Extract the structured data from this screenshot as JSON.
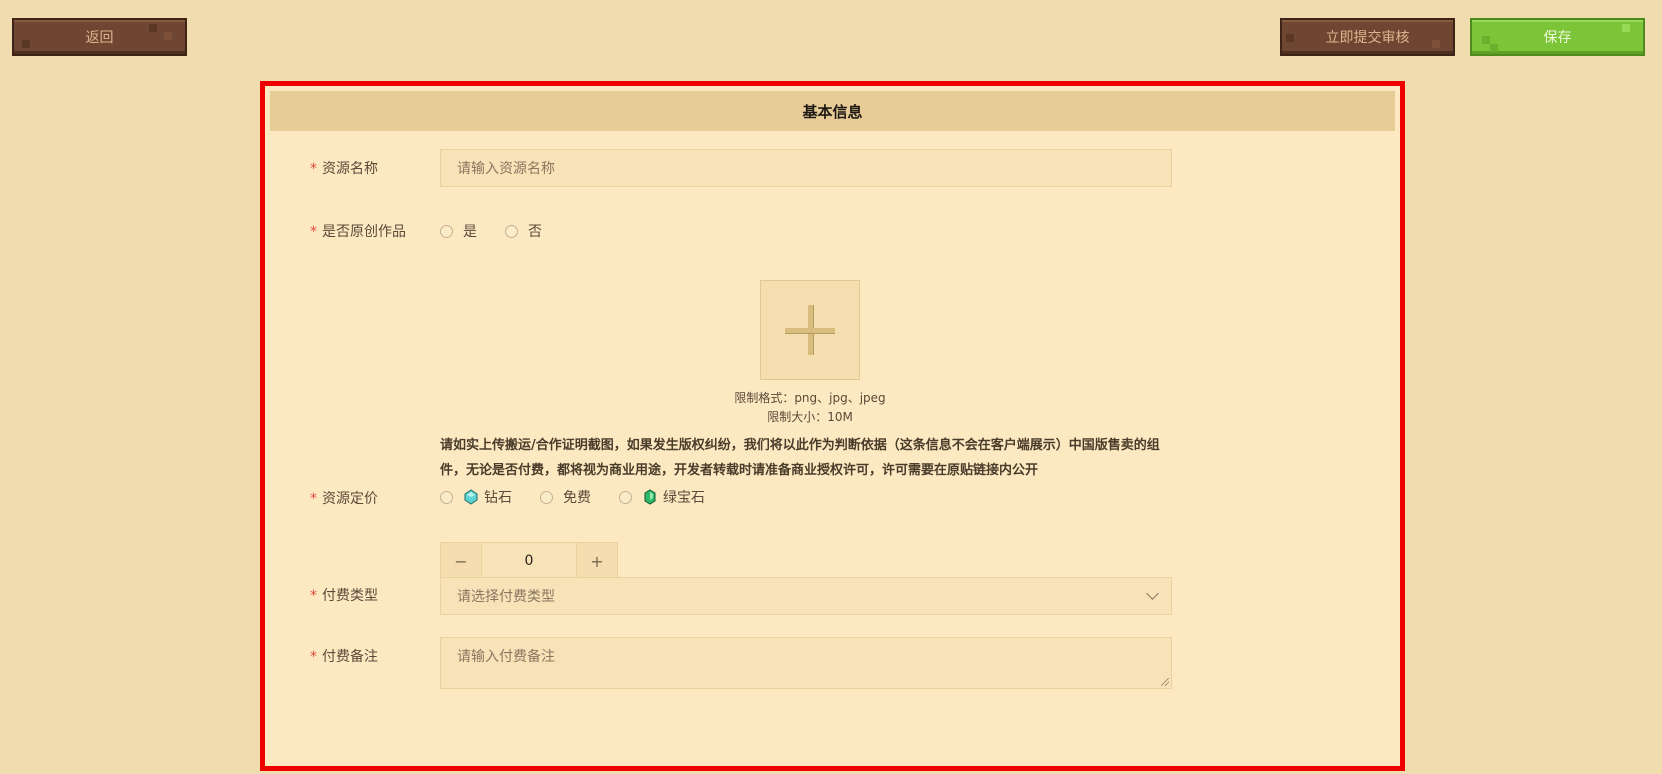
{
  "toolbar": {
    "back_label": "返回",
    "submit_label": "立即提交审核",
    "save_label": "保存"
  },
  "panel": {
    "title": "基本信息"
  },
  "form": {
    "required_mark": "*",
    "resource_name": {
      "label": "资源名称",
      "placeholder": "请输入资源名称"
    },
    "original": {
      "label": "是否原创作品",
      "options": [
        "是",
        "否"
      ]
    },
    "upload": {
      "format_note": "限制格式：png、jpg、jpeg",
      "size_note": "限制大小：10M",
      "notice": "请如实上传搬运/合作证明截图，如果发生版权纠纷，我们将以此作为判断依据（这条信息不会在客户端展示）中国版售卖的组件，无论是否付费，都将视为商业用途，开发者转载时请准备商业授权许可，许可需要在原贴链接内公开"
    },
    "price": {
      "label": "资源定价",
      "options": [
        "钻石",
        "免费",
        "绿宝石"
      ],
      "minus": "−",
      "value": "0",
      "plus": "+"
    },
    "pay_type": {
      "label": "付费类型",
      "placeholder": "请选择付费类型"
    },
    "pay_note": {
      "label": "付费备注",
      "placeholder": "请输入付费备注"
    }
  },
  "colors": {
    "background": "#f0dcae",
    "panel_border": "#ee0000",
    "save_green": "#7cc538",
    "brown_button": "#6e4631"
  }
}
